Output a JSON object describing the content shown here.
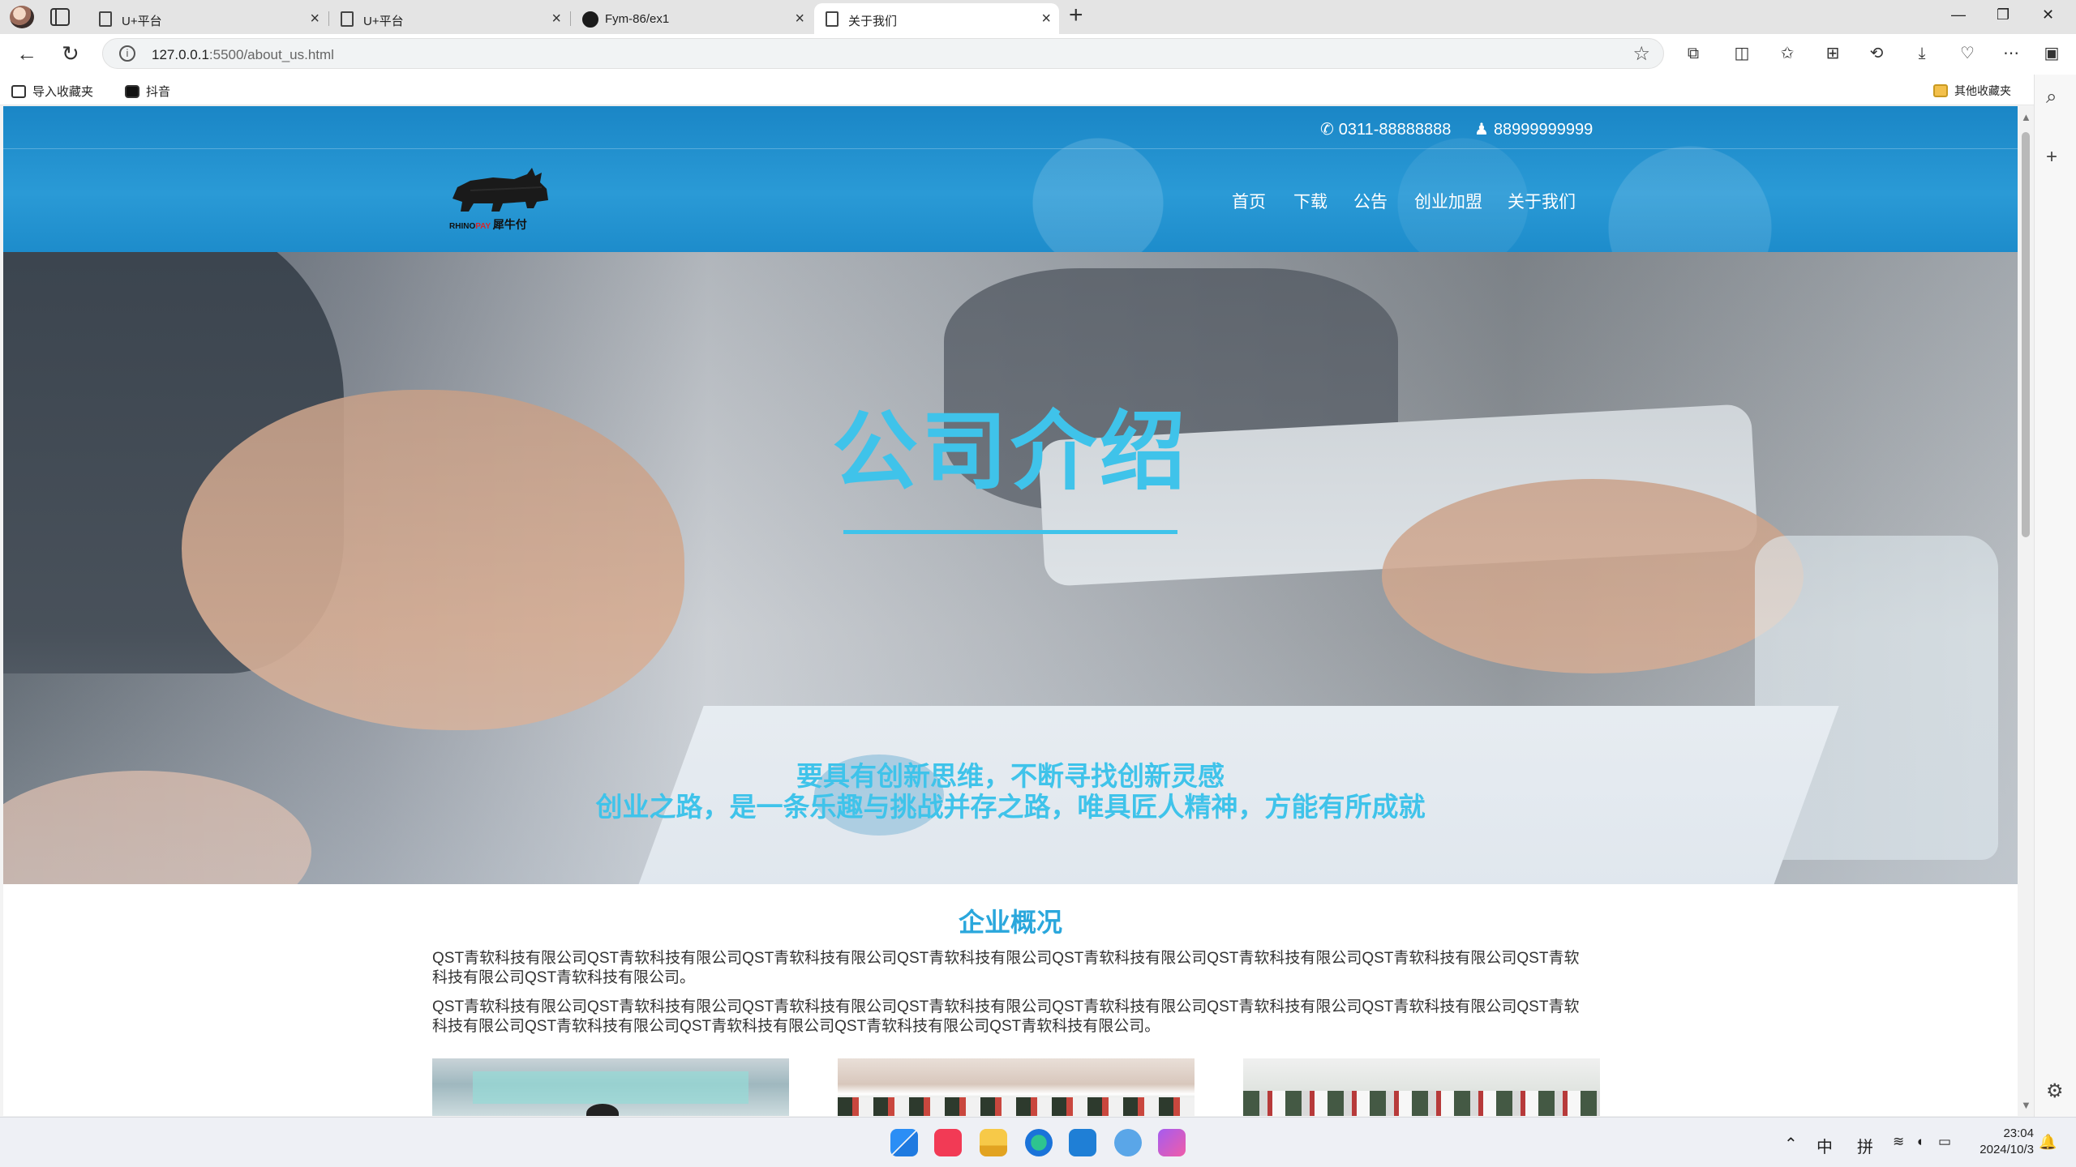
{
  "browser": {
    "tabs": [
      {
        "title": "U+平台",
        "active": false,
        "icon": "page-icon"
      },
      {
        "title": "U+平台",
        "active": false,
        "icon": "page-icon"
      },
      {
        "title": "Fym-86/ex1",
        "active": false,
        "icon": "github-icon"
      },
      {
        "title": "关于我们",
        "active": true,
        "icon": "page-icon"
      }
    ],
    "url_host": "127.0.0.1",
    "url_path": ":5500/about_us.html",
    "bookmarks": [
      {
        "label": "导入收藏夹",
        "icon": "import-icon"
      },
      {
        "label": "抖音",
        "icon": "tiktok-icon"
      }
    ],
    "other_bookmarks": "其他收藏夹"
  },
  "site": {
    "contact_phone": "0311-88888888",
    "contact_qq": "88999999999",
    "logo_brand": "RHINO",
    "logo_brand_accent": "PAY",
    "logo_name": "犀牛付",
    "nav": [
      "首页",
      "下载",
      "公告",
      "创业加盟",
      "关于我们"
    ],
    "banner": {
      "title": "公司介绍",
      "line1": "要具有创新思维，不断寻找创新灵感",
      "line2": "创业之路，是一条乐趣与挑战并存之路，唯具匠人精神，方能有所成就"
    },
    "overview": {
      "title": "企业概况",
      "paragraph1": "QST青软科技有限公司QST青软科技有限公司QST青软科技有限公司QST青软科技有限公司QST青软科技有限公司QST青软科技有限公司QST青软科技有限公司QST青软科技有限公司QST青软科技有限公司。",
      "paragraph2": "QST青软科技有限公司QST青软科技有限公司QST青软科技有限公司QST青软科技有限公司QST青软科技有限公司QST青软科技有限公司QST青软科技有限公司QST青软科技有限公司QST青软科技有限公司QST青软科技有限公司QST青软科技有限公司QST青软科技有限公司。"
    }
  },
  "taskbar": {
    "ime_lang": "中",
    "ime_mode": "拼",
    "time": "23:04",
    "date": "2024/10/3"
  },
  "colors": {
    "accent": "#3fc3ea",
    "header_blue": "#1f90cf",
    "section_title": "#2aa7dc"
  }
}
